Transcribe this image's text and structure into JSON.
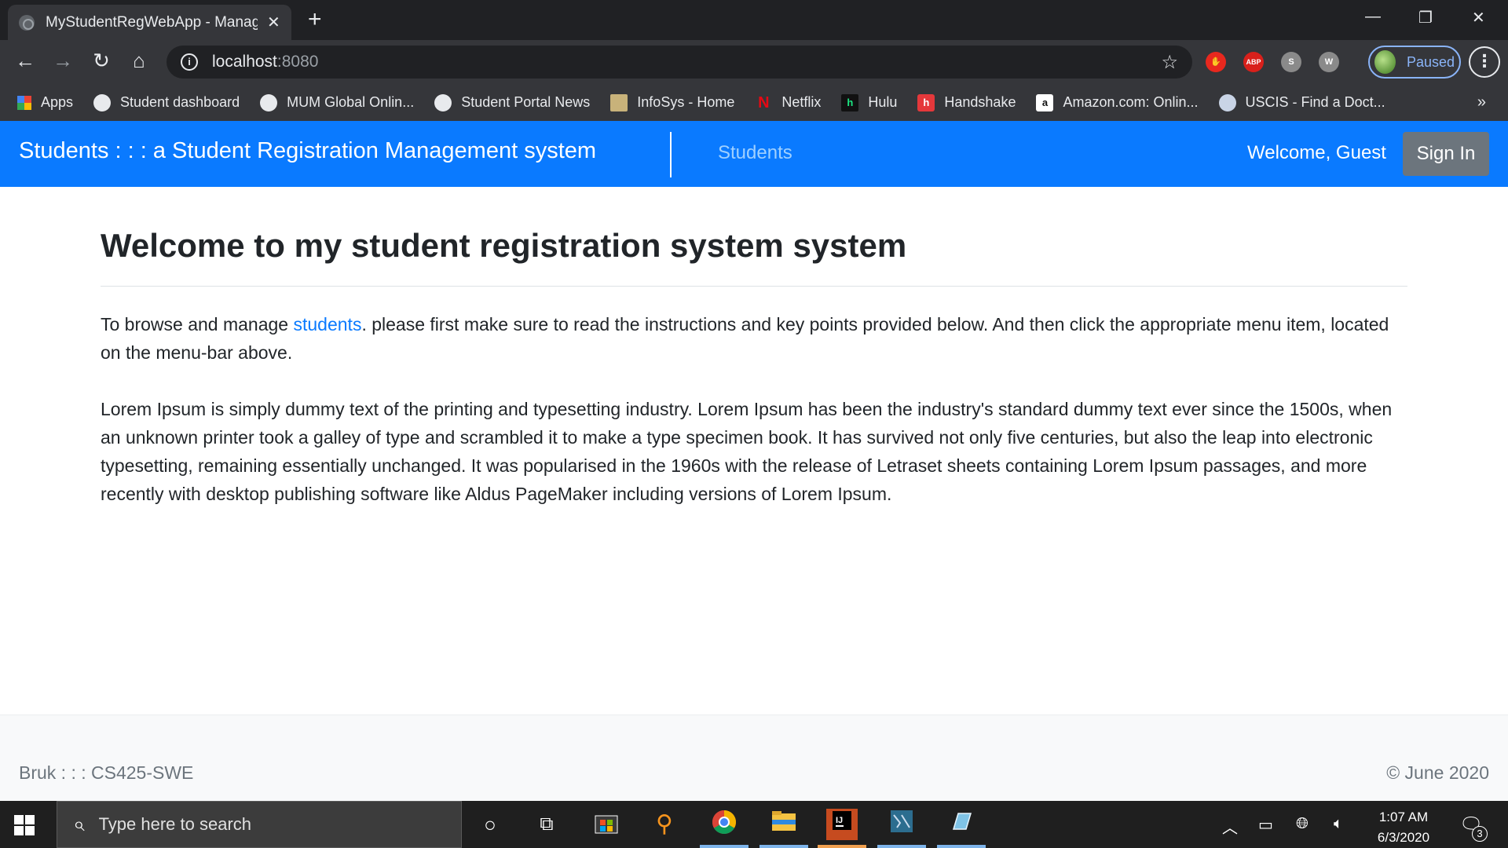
{
  "browser": {
    "tab_title": "MyStudentRegWebApp - Managi",
    "tab_close": "✕",
    "new_tab": "+",
    "window_controls": {
      "minimize": "—",
      "restore": "❐",
      "close": "✕"
    },
    "url_host": "localhost",
    "url_port": ":8080",
    "profile_status": "Paused",
    "extensions": [
      {
        "name": "stop-hand-extension",
        "label": "✋",
        "color": "#e8281e"
      },
      {
        "name": "adblock-plus-extension",
        "label": "ABP",
        "color": "#d9201b"
      },
      {
        "name": "s-extension",
        "label": "S",
        "color": "#8a8a8a"
      },
      {
        "name": "w-extension",
        "label": "W",
        "color": "#8a8a8a"
      }
    ]
  },
  "bookmarks": [
    {
      "label": "Apps",
      "icon": "apps-grid-icon"
    },
    {
      "label": "Student dashboard",
      "icon": "globe-icon"
    },
    {
      "label": "MUM Global Onlin...",
      "icon": "globe-icon"
    },
    {
      "label": "Student Portal News",
      "icon": "globe-icon"
    },
    {
      "label": "InfoSys - Home",
      "icon": "infosys-icon"
    },
    {
      "label": "Netflix",
      "icon": "netflix-icon"
    },
    {
      "label": "Hulu",
      "icon": "hulu-icon"
    },
    {
      "label": "Handshake",
      "icon": "handshake-icon"
    },
    {
      "label": "Amazon.com: Onlin...",
      "icon": "amazon-icon"
    },
    {
      "label": "USCIS - Find a Doct...",
      "icon": "uscis-icon"
    }
  ],
  "bookmarks_more": "»",
  "navbar": {
    "brand": "Students : : : a Student Registration Management system",
    "link_students": "Students",
    "welcome": "Welcome, Guest",
    "sign_in": "Sign In",
    "bg_color": "#0a7aff"
  },
  "main": {
    "heading": "Welcome to my student registration system system",
    "intro_before": "To browse and manage ",
    "intro_link": "students",
    "intro_after": ". please first make sure to read the instructions and key points provided below. And then click the appropriate menu item, located on the menu-bar above.",
    "lorem": "Lorem Ipsum is simply dummy text of the printing and typesetting industry. Lorem Ipsum has been the industry's standard dummy text ever since the 1500s, when an unknown printer took a galley of type and scrambled it to make a type specimen book. It has survived not only five centuries, but also the leap into electronic typesetting, remaining essentially unchanged. It was popularised in the 1960s with the release of Letraset sheets containing Lorem Ipsum passages, and more recently with desktop publishing software like Aldus PageMaker including versions of Lorem Ipsum."
  },
  "footer": {
    "left": "Bruk : : : CS425-SWE",
    "right": "© June 2020"
  },
  "taskbar": {
    "search_placeholder": "Type here to search",
    "time": "1:07 AM",
    "date": "6/3/2020",
    "notification_count": "3"
  }
}
